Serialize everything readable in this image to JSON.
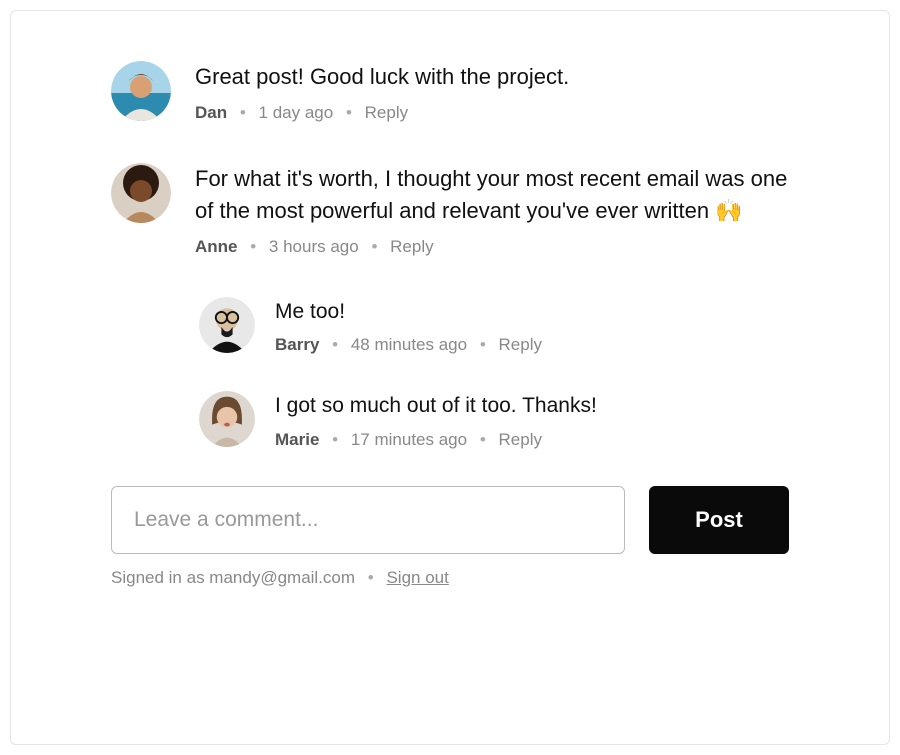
{
  "comments": [
    {
      "text": "Great post! Good luck with the project.",
      "author": "Dan",
      "time": "1 day ago",
      "reply_label": "Reply"
    },
    {
      "text": "For what it's worth, I thought your most recent email was one of the most powerful and relevant you've ever written 🙌",
      "author": "Anne",
      "time": "3 hours ago",
      "reply_label": "Reply"
    },
    {
      "text": "Me too!",
      "author": "Barry",
      "time": "48 minutes ago",
      "reply_label": "Reply"
    },
    {
      "text": "I got so much out of it too. Thanks!",
      "author": "Marie",
      "time": "17 minutes ago",
      "reply_label": "Reply"
    }
  ],
  "composer": {
    "placeholder": "Leave a comment...",
    "post_label": "Post"
  },
  "status": {
    "signed_in_prefix": "Signed in as ",
    "email": "mandy@gmail.com",
    "signout_label": "Sign out"
  },
  "sep": "•"
}
